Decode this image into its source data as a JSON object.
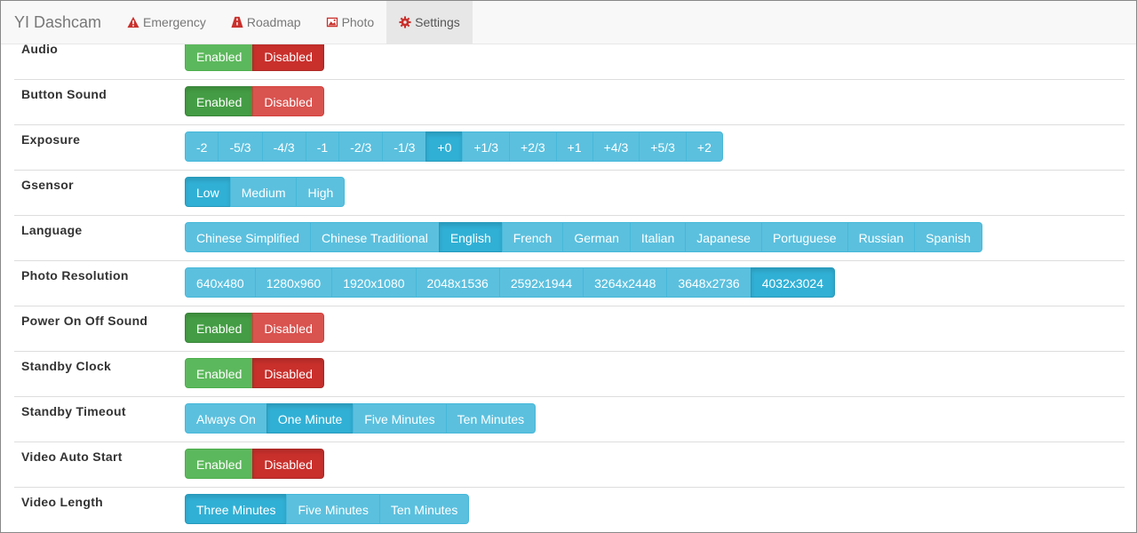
{
  "nav": {
    "brand": "YI Dashcam",
    "items": [
      {
        "label": "Emergency",
        "icon": "warning-icon",
        "active": false
      },
      {
        "label": "Roadmap",
        "icon": "road-icon",
        "active": false
      },
      {
        "label": "Photo",
        "icon": "picture-icon",
        "active": false
      },
      {
        "label": "Settings",
        "icon": "gear-icon",
        "active": true
      }
    ],
    "icon_color": "#c9302c"
  },
  "settings": [
    {
      "label": "Audio",
      "type": "toggle",
      "options": [
        "Enabled",
        "Disabled"
      ],
      "selected": "Disabled"
    },
    {
      "label": "Button Sound",
      "type": "toggle",
      "options": [
        "Enabled",
        "Disabled"
      ],
      "selected": "Enabled"
    },
    {
      "label": "Exposure",
      "type": "choice",
      "options": [
        "-2",
        "-5/3",
        "-4/3",
        "-1",
        "-2/3",
        "-1/3",
        "+0",
        "+1/3",
        "+2/3",
        "+1",
        "+4/3",
        "+5/3",
        "+2"
      ],
      "selected": "+0"
    },
    {
      "label": "Gsensor",
      "type": "choice",
      "options": [
        "Low",
        "Medium",
        "High"
      ],
      "selected": "Low"
    },
    {
      "label": "Language",
      "type": "choice",
      "options": [
        "Chinese Simplified",
        "Chinese Traditional",
        "English",
        "French",
        "German",
        "Italian",
        "Japanese",
        "Portuguese",
        "Russian",
        "Spanish"
      ],
      "selected": "English"
    },
    {
      "label": "Photo Resolution",
      "type": "choice",
      "options": [
        "640x480",
        "1280x960",
        "1920x1080",
        "2048x1536",
        "2592x1944",
        "3264x2448",
        "3648x2736",
        "4032x3024"
      ],
      "selected": "4032x3024"
    },
    {
      "label": "Power On Off Sound",
      "type": "toggle",
      "options": [
        "Enabled",
        "Disabled"
      ],
      "selected": "Enabled"
    },
    {
      "label": "Standby Clock",
      "type": "toggle",
      "options": [
        "Enabled",
        "Disabled"
      ],
      "selected": "Disabled"
    },
    {
      "label": "Standby Timeout",
      "type": "choice",
      "options": [
        "Always On",
        "One Minute",
        "Five Minutes",
        "Ten Minutes"
      ],
      "selected": "One Minute"
    },
    {
      "label": "Video Auto Start",
      "type": "toggle",
      "options": [
        "Enabled",
        "Disabled"
      ],
      "selected": "Disabled"
    },
    {
      "label": "Video Length",
      "type": "choice",
      "options": [
        "Three Minutes",
        "Five Minutes",
        "Ten Minutes"
      ],
      "selected": "Three Minutes"
    }
  ]
}
